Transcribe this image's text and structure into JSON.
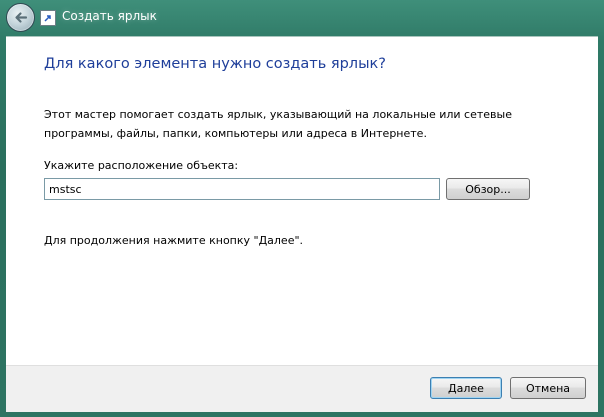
{
  "window": {
    "title": "Создать ярлык"
  },
  "main": {
    "heading": "Для какого элемента нужно создать ярлык?",
    "description": "Этот мастер помогает создать ярлык, указывающий на локальные или сетевые программы, файлы, папки, компьютеры или адреса в Интернете.",
    "location_label": "Укажите расположение объекта:",
    "location_value": "mstsc",
    "browse_label": "Обзор...",
    "continue_hint": "Для продолжения нажмите кнопку \"Далее\"."
  },
  "footer": {
    "next_label": "Далее",
    "cancel_label": "Отмена"
  },
  "icons": {
    "back": "back-arrow-icon",
    "shortcut": "shortcut-icon"
  }
}
